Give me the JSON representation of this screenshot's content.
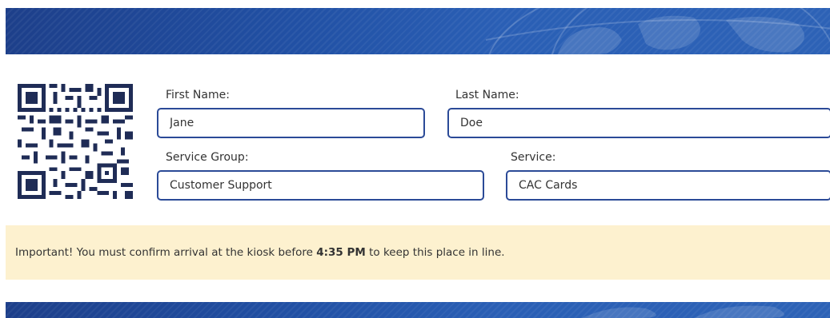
{
  "form": {
    "first_name": {
      "label": "First Name:",
      "value": "Jane"
    },
    "last_name": {
      "label": "Last Name:",
      "value": "Doe"
    },
    "service_group": {
      "label": "Service Group:",
      "value": "Customer Support"
    },
    "service": {
      "label": "Service:",
      "value": "CAC Cards"
    }
  },
  "notice": {
    "prefix": "Important! You must confirm arrival at the kiosk before ",
    "time": "4:35 PM",
    "suffix": " to keep this place in line."
  },
  "colors": {
    "banner": "#2150a4",
    "input_border": "#2b4a97",
    "notice_bg": "#fdf1cf"
  },
  "icons": {
    "qr": "qr-code"
  }
}
